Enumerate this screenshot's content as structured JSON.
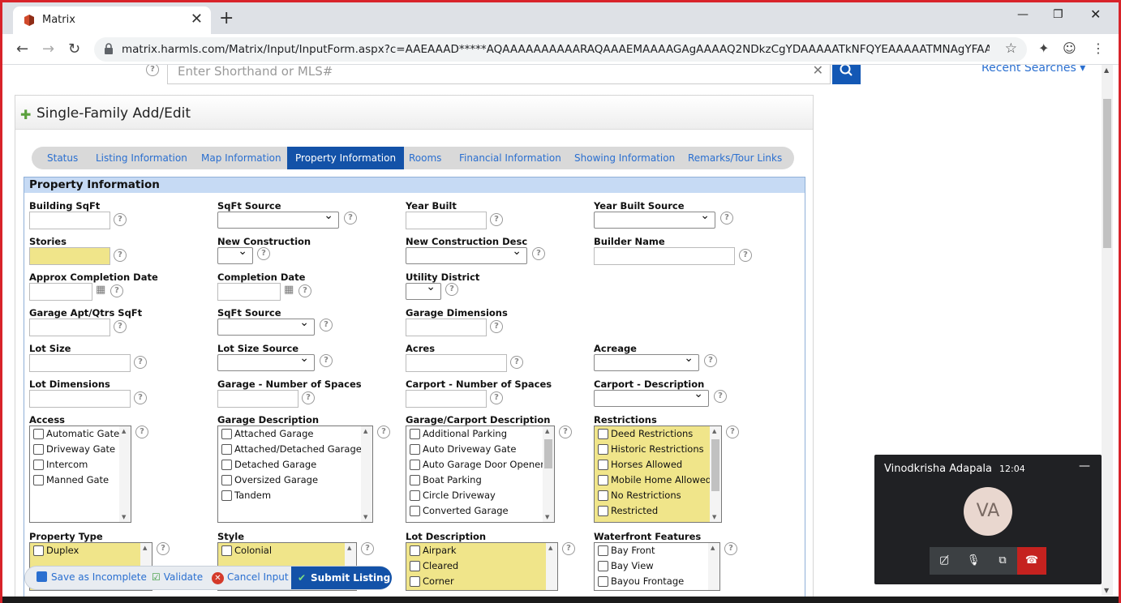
{
  "browser": {
    "tab_title": "Matrix",
    "url": "matrix.harmls.com/Matrix/Input/InputForm.aspx?c=AAEAAAD*****AQAAAAAAAAAARAQAAAEMAAAAGAgAAAAQ2NDkzCgYDAAAAATkNFQYEAAAAATMNAgYFAAAAATcNAg..."
  },
  "header": {
    "search_placeholder": "Enter Shorthand or MLS#",
    "recent_searches": "Recent Searches ▾"
  },
  "form": {
    "title": "Single-Family Add/Edit",
    "steps": [
      "Status",
      "Listing Information",
      "Map Information",
      "Property Information",
      "Rooms",
      "Financial Information",
      "Showing Information",
      "Remarks/Tour Links"
    ],
    "active_step": "Property Information",
    "section_title": "Property Information",
    "fields": {
      "building_sqft": "Building SqFt",
      "sqft_source": "SqFt Source",
      "year_built": "Year Built",
      "year_built_source": "Year Built Source",
      "stories": "Stories",
      "new_construction": "New Construction",
      "new_construction_desc": "New Construction Desc",
      "builder_name": "Builder Name",
      "approx_completion_date": "Approx Completion Date",
      "completion_date": "Completion Date",
      "utility_district": "Utility District",
      "garage_apt_sqft": "Garage Apt/Qtrs SqFt",
      "sqft_source_2": "SqFt Source",
      "garage_dimensions": "Garage Dimensions",
      "lot_size": "Lot Size",
      "lot_size_source": "Lot Size Source",
      "acres": "Acres",
      "acreage": "Acreage",
      "lot_dimensions": "Lot Dimensions",
      "garage_spaces": "Garage - Number of Spaces",
      "carport_spaces": "Carport - Number of Spaces",
      "carport_description": "Carport - Description",
      "access": "Access",
      "garage_description": "Garage Description",
      "garage_carport_description": "Garage/Carport Description",
      "restrictions": "Restrictions",
      "property_type": "Property Type",
      "style": "Style",
      "lot_description": "Lot Description",
      "waterfront_features": "Waterfront Features"
    },
    "lists": {
      "access": [
        "Automatic Gate",
        "Driveway Gate",
        "Intercom",
        "Manned Gate"
      ],
      "garage_description": [
        "Attached Garage",
        "Attached/Detached Garage",
        "Detached Garage",
        "Oversized Garage",
        "Tandem"
      ],
      "garage_carport": [
        "Additional Parking",
        "Auto Driveway Gate",
        "Auto Garage Door Opener",
        "Boat Parking",
        "Circle Driveway",
        "Converted Garage"
      ],
      "restrictions": [
        "Deed Restrictions",
        "Historic Restrictions",
        "Horses Allowed",
        "Mobile Home Allowed",
        "No Restrictions",
        "Restricted"
      ],
      "property_type": [
        "Duplex"
      ],
      "style": [
        "Colonial"
      ],
      "lot_description": [
        "Airpark",
        "Cleared",
        "Corner"
      ],
      "waterfront": [
        "Bay Front",
        "Bay View",
        "Bayou Frontage"
      ]
    }
  },
  "actions": {
    "save_incomplete": "Save as Incomplete",
    "validate": "Validate",
    "cancel": "Cancel Input",
    "submit": "Submit Listing"
  },
  "meet": {
    "name": "Vinodkrisha Adapala",
    "time": "12:04",
    "initials": "VA"
  },
  "colors": {
    "accent": "#1352a8",
    "required": "#f0e58a",
    "section": "#c6daf4"
  }
}
